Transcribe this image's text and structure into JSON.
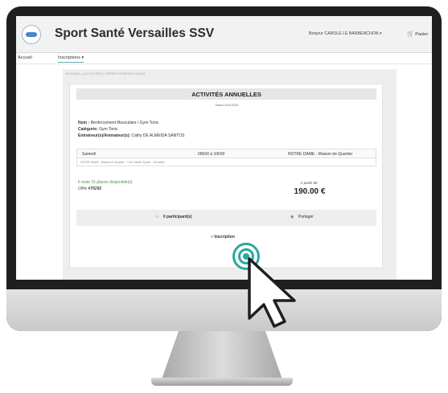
{
  "header": {
    "site_title": "Sport Santé Versailles SSV",
    "greeting": "Bonjour CAROLE LE BARBENCHON",
    "greeting_caret": "▾",
    "cart_label": "Panier"
  },
  "nav": {
    "accueil": "Accueil",
    "inscriptions": "Inscriptions",
    "inscriptions_caret": "▾"
  },
  "breadcrumb": "ACCUEIL  |  ACTIVITÉS  |  OFFRE FITNESS #76292",
  "card": {
    "title": "ACTIVITÉS ANNUELLES",
    "season": "Saison 2021/2022",
    "nom_label": "Nom :",
    "nom_value": "Renforcement Musculaire / Gym Tonic",
    "categorie_label": "Catégorie:",
    "categorie_value": "Gym Tonic",
    "entraineur_label": "Entraineur(s)/Animateur(s):",
    "entraineur_value": "Cathy DE ALMEIDA SANTOS",
    "schedule": {
      "day": "Samedi",
      "time": "09h00 à 10h00",
      "location": "NOTRE DAME - Maison de Quartier"
    },
    "address": "NOTRE DAME - Maison de Quartier - 7 rue Sainte Sophie - Versailles",
    "places": "Il reste 15 places disponible(s)",
    "offer_label": "Offre",
    "offer_code": "#76292",
    "from_label": "À partir de",
    "price": "190.00 €",
    "participants": "0 participant(s)",
    "share": "Partager",
    "inscription": "Inscription"
  },
  "icons": {
    "participants": "users-icon",
    "share": "eye-icon",
    "cart": "cart-icon",
    "cursor": "mouse-pointer-icon"
  },
  "colors": {
    "accent": "#2ba89d",
    "available": "#3c9b3c",
    "nav_underline": "#6aa5b8"
  }
}
